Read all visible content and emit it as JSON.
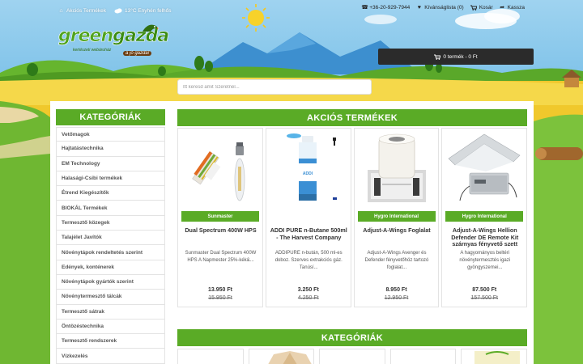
{
  "header": {
    "sale_link": "Akciós Termékek",
    "weather": "13°C Enyhén felhős",
    "phone": "+36-20-929-7944",
    "wishlist": "Kívánságlista (0)",
    "cart": "Kosár",
    "checkout": "Kassza"
  },
  "logo": {
    "text_green": "green",
    "text_gazda": "gazda",
    "sub": "kertészeti webáruház",
    "tag": "a jó gazda!"
  },
  "cart_bar": {
    "label": "0 termék - 0 Ft"
  },
  "search": {
    "placeholder": "Itt keresd amit Szeretnél..."
  },
  "sidebar": {
    "title": "KATEGÓRIÁK",
    "items": [
      "Vetőmagok",
      "Hajtatástechnika",
      "EM Technology",
      "Halasági-Csibi termékek",
      "Étrend Kiegészítők",
      "BIOKÁL Termékek",
      "Termesztő közegek",
      "Talajélet Javítók",
      "Növénytápok rendeltetés szerint",
      "Edények, konténerek",
      "Növénytápok gyártók szerint",
      "Növénytermesztő tálcák",
      "Termesztő sátrak",
      "Öntözéstechnika",
      "Termesztő rendszerek",
      "Vízkezelés"
    ]
  },
  "sale": {
    "title": "AKCIÓS TERMÉKEK",
    "products": [
      {
        "brand": "Sunmaster",
        "name": "Dual Spectrum 400W HPS",
        "desc": "Sunmaster Dual Spectrum 400W HPS    A Napmester  25%-kék&...",
        "price": "13.950 Ft",
        "old_price": "15.950 Ft"
      },
      {
        "brand": "",
        "name": "ADDI PURE n-Butane 500ml - The Harvest Company",
        "desc": "ADDIPURE n-bután, 500 ml-es doboz. Szerves extrakciós gáz. Tanúsí...",
        "price": "3.250 Ft",
        "old_price": "4.250 Ft"
      },
      {
        "brand": "Hygro International",
        "name": "Adjust-A-Wings Foglalat",
        "desc": "Adjust-A-Wings Avenger és Defender fényvetőhöz tartozó foglalat...",
        "price": "8.950 Ft",
        "old_price": "12.950 Ft"
      },
      {
        "brand": "Hygro International",
        "name": "Adjust-A-Wings Hellion Defender DE Remote Kit szárnyas fényvető szett",
        "desc": "A hagyományos beltéri növénytermesztés igazi gyöngyszemei...",
        "price": "87.500 Ft",
        "old_price": "157.500 Ft"
      }
    ]
  },
  "categories_section": {
    "title": "KATEGÓRIÁK"
  },
  "colors": {
    "accent_green": "#5aab26",
    "cart_bar": "#2b2b2b"
  }
}
